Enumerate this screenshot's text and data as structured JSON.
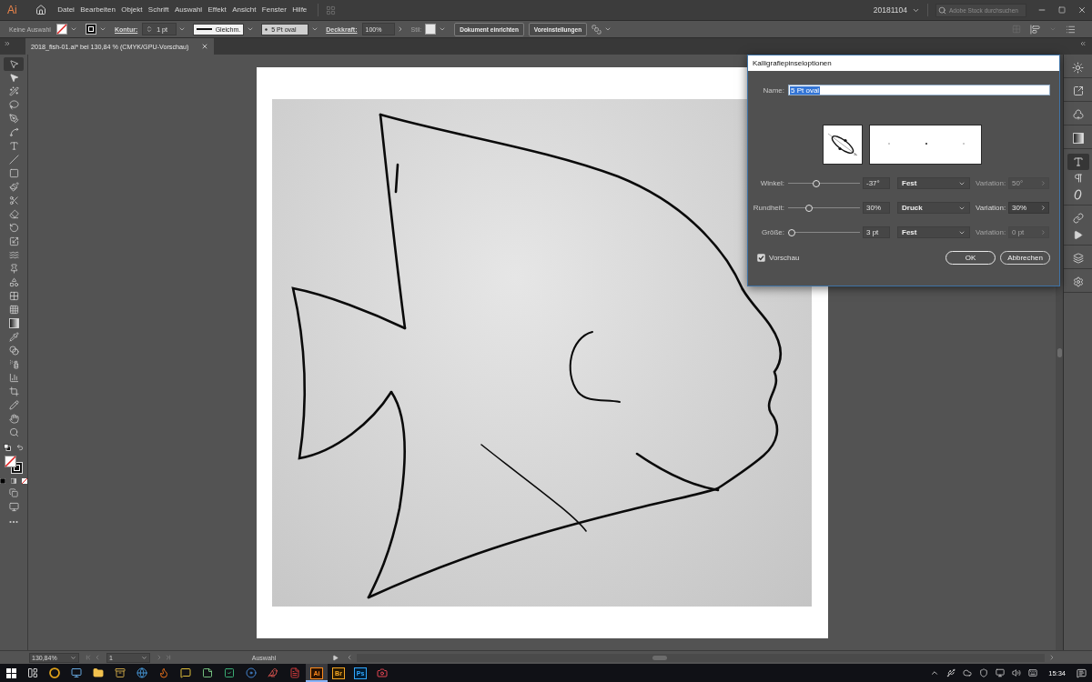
{
  "menubar": {
    "logo": "Ai",
    "items": [
      "Datei",
      "Bearbeiten",
      "Objekt",
      "Schrift",
      "Auswahl",
      "Effekt",
      "Ansicht",
      "Fenster",
      "Hilfe"
    ],
    "workspace": "20181104",
    "search": {
      "placeholder": "Adobe Stock durchsuchen"
    }
  },
  "control_bar": {
    "selection": "Keine Auswahl",
    "stroke_label": "Kontur:",
    "stroke_weight": "1 pt",
    "stroke_profile": "Gleichm.",
    "brush": "5 Pt oval",
    "opacity_label": "Deckkraft:",
    "opacity": "100%",
    "style_label": "Stil:",
    "buttons": [
      "Dokument einrichten",
      "Voreinstellungen"
    ]
  },
  "document_tabs": [
    {
      "label": "2018_fish-01.ai* bei 130,84 % (CMYK/GPU-Vorschau)",
      "selected": true
    }
  ],
  "tools": [
    {
      "kind": "selection",
      "selected": true
    },
    {
      "kind": "direct-selection",
      "selected": false
    },
    {
      "kind": "magic-wand",
      "selected": false
    },
    {
      "kind": "lasso",
      "selected": false
    },
    {
      "kind": "pen",
      "selected": false
    },
    {
      "kind": "curvature",
      "selected": false
    },
    {
      "kind": "type",
      "selected": false
    },
    {
      "kind": "line",
      "selected": false
    },
    {
      "kind": "rectangle",
      "selected": false
    },
    {
      "kind": "paintbrush",
      "selected": false
    },
    {
      "kind": "scissors",
      "selected": false
    },
    {
      "kind": "eraser",
      "selected": false
    },
    {
      "kind": "rotate",
      "selected": false
    },
    {
      "kind": "scale",
      "selected": false
    },
    {
      "kind": "warp",
      "selected": false
    },
    {
      "kind": "pin",
      "selected": false
    },
    {
      "kind": "shape-builder",
      "selected": false
    },
    {
      "kind": "perspective",
      "selected": false
    },
    {
      "kind": "mesh",
      "selected": false
    },
    {
      "kind": "gradient",
      "selected": false
    },
    {
      "kind": "eyedropper",
      "selected": false
    },
    {
      "kind": "blend",
      "selected": false
    },
    {
      "kind": "symbol",
      "selected": false
    },
    {
      "kind": "graph",
      "selected": false
    },
    {
      "kind": "artboard",
      "selected": false
    },
    {
      "kind": "knife",
      "selected": false
    },
    {
      "kind": "hand",
      "selected": false
    },
    {
      "kind": "zoom",
      "selected": false
    }
  ],
  "panel_groups": [
    {
      "panels": [
        {
          "kind": "appearance",
          "selected": false
        }
      ]
    },
    {
      "panels": [
        {
          "kind": "export",
          "selected": false
        }
      ]
    },
    {
      "panels": [
        {
          "kind": "symbols",
          "selected": false
        }
      ]
    },
    {
      "panels": [
        {
          "kind": "gradient",
          "selected": false
        }
      ]
    },
    {
      "panels": [
        {
          "kind": "character",
          "selected": true
        },
        {
          "kind": "paragraph",
          "selected": false
        },
        {
          "kind": "opentype",
          "selected": false
        }
      ]
    },
    {
      "panels": [
        {
          "kind": "links",
          "selected": false
        },
        {
          "kind": "actions",
          "selected": false
        }
      ]
    },
    {
      "panels": [
        {
          "kind": "layers",
          "selected": false
        }
      ]
    },
    {
      "panels": [
        {
          "kind": "settings",
          "selected": false
        }
      ]
    }
  ],
  "dialog": {
    "title": "Kalligrafiepinseloptionen",
    "name_label": "Name:",
    "name": {
      "value": "5 Pt oval",
      "highlighted": true
    },
    "rows": [
      {
        "label": "Winkel:",
        "level": 0.38,
        "value": "-37°",
        "mode": "Fest",
        "variation_label": "Variation:",
        "variation": "50°",
        "disabled": true
      },
      {
        "label": "Rundheit:",
        "level": 0.27,
        "value": "30%",
        "mode": "Druck",
        "variation_label": "Variation:",
        "variation": "30%",
        "disabled": false
      },
      {
        "label": "Größe:",
        "level": 0,
        "value": "3 pt",
        "mode": "Fest",
        "variation_label": "Variation:",
        "variation": "0 pt",
        "disabled": true
      }
    ],
    "preview": {
      "label": "Vorschau",
      "checked": true
    },
    "buttons": [
      {
        "label": "OK",
        "kind": "default"
      },
      {
        "label": "Abbrechen",
        "kind": "cancel"
      }
    ]
  },
  "status_bar": {
    "zoom": "130,84%",
    "artboard": "1",
    "mode": "Auswahl"
  },
  "taskbar": {
    "apps": [
      {
        "kind": "task-view",
        "selected": false
      },
      {
        "kind": "browser",
        "selected": false
      },
      {
        "kind": "monitor",
        "selected": false
      },
      {
        "kind": "folder",
        "selected": false
      },
      {
        "kind": "archive",
        "selected": false
      },
      {
        "kind": "globe",
        "selected": false
      },
      {
        "kind": "flame",
        "selected": false
      },
      {
        "kind": "chat",
        "selected": false
      },
      {
        "kind": "notes",
        "selected": false
      },
      {
        "kind": "check",
        "selected": false
      },
      {
        "kind": "disc",
        "selected": false
      },
      {
        "kind": "bird",
        "selected": false
      },
      {
        "kind": "document",
        "selected": false
      },
      {
        "kind": "orange-tile",
        "label": "Ai",
        "selected": true
      },
      {
        "kind": "amber-tile",
        "label": "Br",
        "selected": false
      },
      {
        "kind": "blue-tile",
        "label": "Ps",
        "selected": false
      },
      {
        "kind": "camera",
        "selected": false
      }
    ],
    "time": "15:34"
  }
}
